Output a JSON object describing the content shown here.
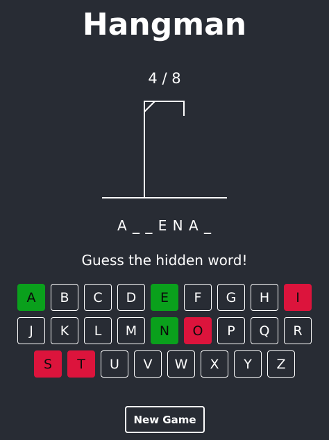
{
  "header": {
    "title": "Hangman"
  },
  "status": {
    "counter": "4 / 8",
    "masked_word": "A _ _ E N A _",
    "prompt": "Guess the hidden word!"
  },
  "wrong_guesses": 4,
  "max_guesses": 8,
  "colors": {
    "background": "#282c34",
    "correct": "#0aa01c",
    "wrong": "#dc143c"
  },
  "keyboard": {
    "rows": [
      [
        {
          "letter": "A",
          "state": "correct"
        },
        {
          "letter": "B",
          "state": "unused"
        },
        {
          "letter": "C",
          "state": "unused"
        },
        {
          "letter": "D",
          "state": "unused"
        },
        {
          "letter": "E",
          "state": "correct"
        },
        {
          "letter": "F",
          "state": "unused"
        },
        {
          "letter": "G",
          "state": "unused"
        },
        {
          "letter": "H",
          "state": "unused"
        },
        {
          "letter": "I",
          "state": "wrong"
        }
      ],
      [
        {
          "letter": "J",
          "state": "unused"
        },
        {
          "letter": "K",
          "state": "unused"
        },
        {
          "letter": "L",
          "state": "unused"
        },
        {
          "letter": "M",
          "state": "unused"
        },
        {
          "letter": "N",
          "state": "correct"
        },
        {
          "letter": "O",
          "state": "wrong"
        },
        {
          "letter": "P",
          "state": "unused"
        },
        {
          "letter": "Q",
          "state": "unused"
        },
        {
          "letter": "R",
          "state": "unused"
        }
      ],
      [
        {
          "letter": "S",
          "state": "wrong"
        },
        {
          "letter": "T",
          "state": "wrong"
        },
        {
          "letter": "U",
          "state": "unused"
        },
        {
          "letter": "V",
          "state": "unused"
        },
        {
          "letter": "W",
          "state": "unused"
        },
        {
          "letter": "X",
          "state": "unused"
        },
        {
          "letter": "Y",
          "state": "unused"
        },
        {
          "letter": "Z",
          "state": "unused"
        }
      ]
    ]
  },
  "actions": {
    "new_game_label": "New Game"
  }
}
